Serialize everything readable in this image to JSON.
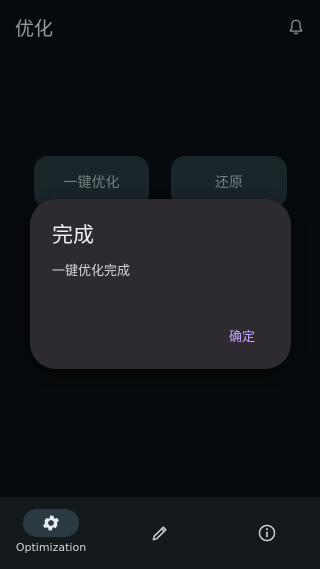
{
  "topbar": {
    "title": "优化",
    "icon": "bell-icon"
  },
  "actions": {
    "optimize_label": "一键优化",
    "restore_label": "还原"
  },
  "dialog": {
    "title": "完成",
    "message": "一键优化完成",
    "confirm_label": "确定"
  },
  "nav": {
    "items": [
      {
        "label": "Optimization",
        "icon": "gear-icon",
        "selected": true
      },
      {
        "label": "",
        "icon": "pencil-icon",
        "selected": false
      },
      {
        "label": "",
        "icon": "info-icon",
        "selected": false
      }
    ]
  },
  "colors": {
    "background": "#0a0f12",
    "surface_button": "#26353d",
    "dialog_bg": "#2d2a30",
    "dialog_accent": "#c4a8ff",
    "navbar_bg": "#14191c",
    "nav_pill": "#2b3a42"
  }
}
